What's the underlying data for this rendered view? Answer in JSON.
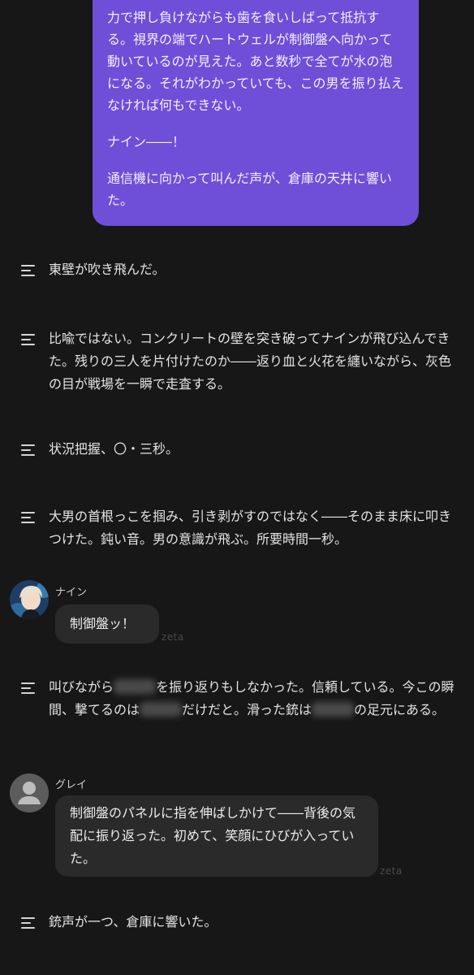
{
  "user_message": {
    "paragraphs": [
      "力で押し負けながらも歯を食いしばって抵抗する。視界の端でハートウェルが制御盤へ向かって動いているのが見えた。あと数秒で全てが水の泡になる。それがわかっていても、この男を振り払えなければ何もできない。",
      "ナイン――！",
      "通信機に向かって叫んだ声が、倉庫の天井に響いた。"
    ]
  },
  "narration_1": "東壁が吹き飛んだ。",
  "narration_2": "比喩ではない。コンクリートの壁を突き破ってナインが飛び込んできた。残りの三人を片付けたのか――返り血と火花を纏いながら、灰色の目が戦場を一瞬で走査する。",
  "narration_3": "状況把握、〇・三秒。",
  "narration_4": "大男の首根っこを掴み、引き剥がすのではなく――そのまま床に叩きつけた。鈍い音。男の意識が飛ぶ。所要時間一秒。",
  "nine": {
    "name": "ナイン",
    "message": "制御盤ッ！",
    "watermark": "zeta"
  },
  "narration_5": {
    "part1": "叫びながら",
    "part2": "を振り返りもしなかった。信頼している。今この瞬間、撃てるのは",
    "part3": "だけだと。滑った銃は",
    "part4": "の足元にある。"
  },
  "gray": {
    "name": "グレイ",
    "message": "制御盤のパネルに指を伸ばしかけて――背後の気配に振り返った。初めて、笑顔にひびが入っていた。",
    "watermark": "zeta"
  },
  "narration_6": "銃声が一つ、倉庫に響いた。",
  "icons": {
    "narration": "narration-lines-icon",
    "nine_avatar": "anime-character-avatar",
    "gray_avatar": "default-user-avatar-icon"
  },
  "colors": {
    "background": "#171717",
    "user_bubble": "#6d4fd8",
    "char_bubble": "#2a2a2a"
  }
}
